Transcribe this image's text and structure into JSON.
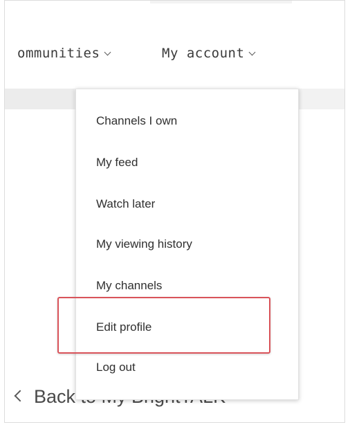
{
  "nav": {
    "items": [
      {
        "label": "ommunities"
      },
      {
        "label": "My account"
      }
    ]
  },
  "menu": {
    "items": [
      {
        "label": "Channels I own"
      },
      {
        "label": "My feed"
      },
      {
        "label": "Watch later"
      },
      {
        "label": "My viewing history"
      },
      {
        "label": "My channels"
      },
      {
        "label": "Edit profile"
      },
      {
        "label": "Log out"
      }
    ],
    "highlighted_item": "Edit profile",
    "highlight_color": "#d9535a"
  },
  "back_link": {
    "label": "Back to My BrightTALK"
  }
}
